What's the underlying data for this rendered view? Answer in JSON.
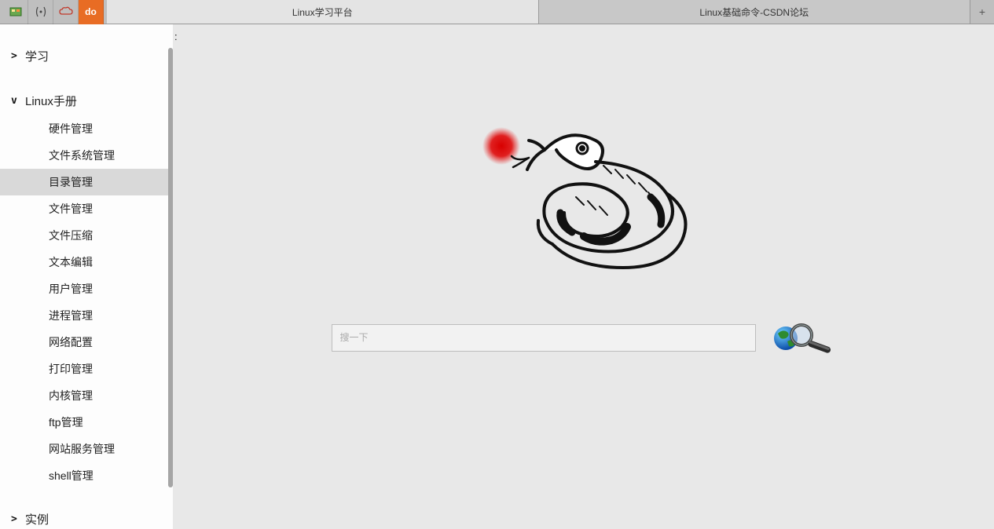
{
  "tabs": {
    "active": "Linux学习平台",
    "inactive": "Linux基础命令-CSDN论坛"
  },
  "sidebar": {
    "sections": [
      {
        "chevron": ">",
        "label": "学习",
        "expanded": false,
        "items": []
      },
      {
        "chevron": "v",
        "label": "Linux手册",
        "expanded": true,
        "items": [
          "硬件管理",
          "文件系统管理",
          "目录管理",
          "文件管理",
          "文件压缩",
          "文本编辑",
          "用户管理",
          "进程管理",
          "网络配置",
          "打印管理",
          "内核管理",
          "ftp管理",
          "网站服务管理",
          "shell管理"
        ],
        "selected_index": 2
      },
      {
        "chevron": ">",
        "label": "实例",
        "expanded": false,
        "items": []
      }
    ]
  },
  "content": {
    "colon": ":",
    "search_placeholder": "搜一下"
  },
  "icons": {
    "tabbar_do": "do"
  }
}
